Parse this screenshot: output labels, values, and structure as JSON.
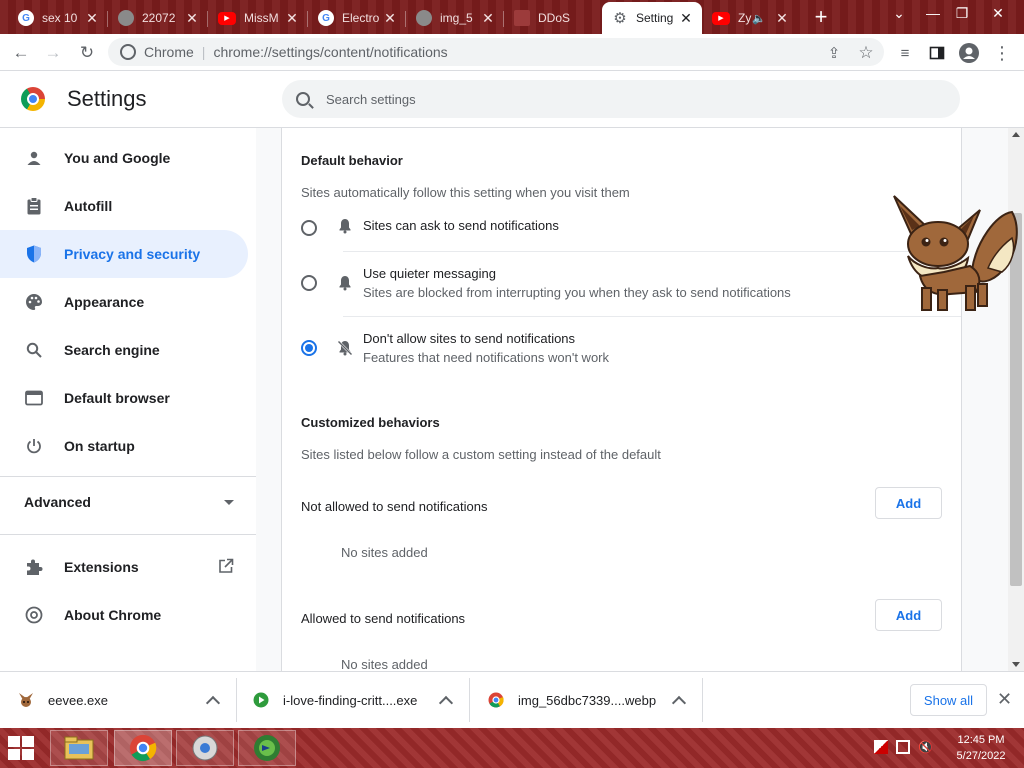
{
  "browser": {
    "tabs": [
      {
        "title": "sex 10",
        "favicon": "google-icon"
      },
      {
        "title": "22072",
        "favicon": "image-icon"
      },
      {
        "title": "MissM",
        "favicon": "youtube-icon"
      },
      {
        "title": "Electro",
        "favicon": "google-icon"
      },
      {
        "title": "img_5",
        "favicon": "image-icon"
      },
      {
        "title": "DDoS",
        "favicon": "ddos-icon"
      },
      {
        "title": "Setting",
        "favicon": "gear-icon",
        "active": true
      },
      {
        "title": "Zy",
        "favicon": "youtube-icon",
        "audio": true
      }
    ],
    "new_tab": "+",
    "address": {
      "origin": "Chrome",
      "url": "chrome://settings/content/notifications"
    }
  },
  "settings": {
    "title": "Settings",
    "search_placeholder": "Search settings",
    "nav": [
      {
        "label": "You and Google",
        "icon": "person-icon"
      },
      {
        "label": "Autofill",
        "icon": "clipboard-icon"
      },
      {
        "label": "Privacy and security",
        "icon": "shield-icon",
        "selected": true
      },
      {
        "label": "Appearance",
        "icon": "palette-icon"
      },
      {
        "label": "Search engine",
        "icon": "search-icon"
      },
      {
        "label": "Default browser",
        "icon": "browser-icon"
      },
      {
        "label": "On startup",
        "icon": "power-icon"
      }
    ],
    "advanced": "Advanced",
    "extensions": "Extensions",
    "about": "About Chrome"
  },
  "content": {
    "default_behavior": {
      "title": "Default behavior",
      "subtitle": "Sites automatically follow this setting when you visit them",
      "options": [
        {
          "label": "Sites can ask to send notifications",
          "sub": "",
          "selected": false
        },
        {
          "label": "Use quieter messaging",
          "sub": "Sites are blocked from interrupting you when they ask to send notifications",
          "selected": false
        },
        {
          "label": "Don't allow sites to send notifications",
          "sub": "Features that need notifications won't work",
          "selected": true
        }
      ]
    },
    "customized": {
      "title": "Customized behaviors",
      "subtitle": "Sites listed below follow a custom setting instead of the default",
      "not_allowed_label": "Not allowed to send notifications",
      "allowed_label": "Allowed to send notifications",
      "add_label": "Add",
      "no_sites": "No sites added"
    }
  },
  "downloads": {
    "items": [
      {
        "name": "eevee.exe",
        "icon": "eevee-icon"
      },
      {
        "name": "i-love-finding-critt....exe",
        "icon": "app-icon"
      },
      {
        "name": "img_56dbc7339....webp",
        "icon": "chrome-icon"
      }
    ],
    "show_all": "Show all"
  },
  "taskbar": {
    "time": "12:45 PM",
    "date": "5/27/2022"
  },
  "colors": {
    "accent": "#1a73e8",
    "tabstrip": "#7a1c1c",
    "taskbar": "#9b2a2a"
  }
}
